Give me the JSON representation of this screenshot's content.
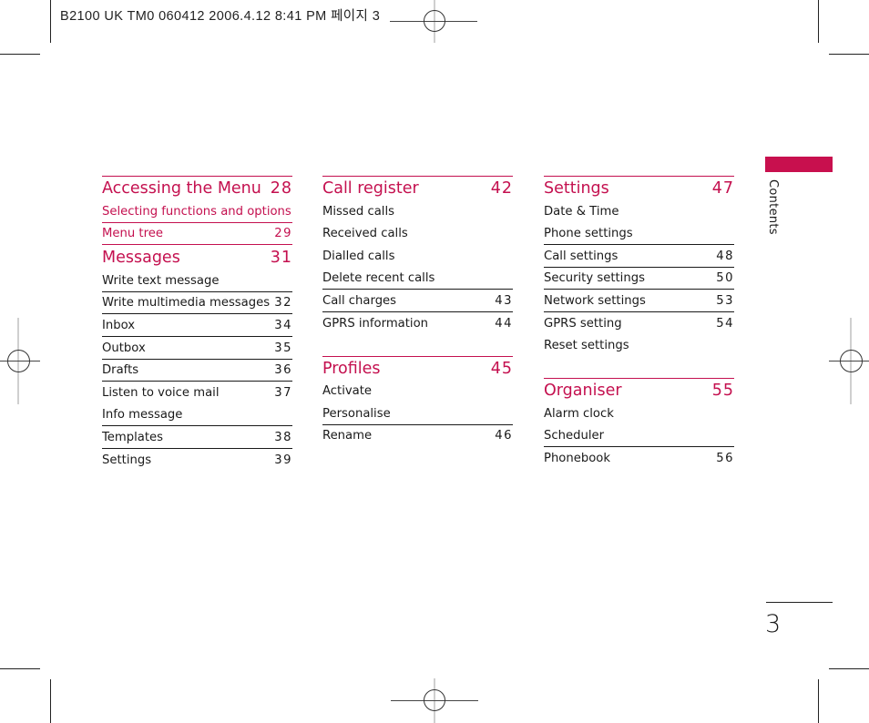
{
  "print_header": {
    "text": "B2100 UK TM0 060412  2006.4.12 8:41 PM 페이지 3"
  },
  "side_tab": {
    "label": "Contents",
    "accent_color": "#c8104e"
  },
  "page_number": "3",
  "columns": [
    {
      "entries": [
        {
          "type": "section",
          "label": "Accessing the Menu",
          "page": "28",
          "separator": false
        },
        {
          "type": "sub",
          "label": "Selecting functions and options",
          "page": "",
          "separator": false
        },
        {
          "type": "sub",
          "label": "Menu tree",
          "page": "29",
          "separator": true
        },
        {
          "type": "section",
          "label": "Messages",
          "page": "31",
          "separator": true
        },
        {
          "type": "item",
          "label": "Write text message",
          "page": "",
          "separator": false
        },
        {
          "type": "item",
          "label": "Write multimedia messages",
          "page": "32",
          "separator": true
        },
        {
          "type": "item",
          "label": "Inbox",
          "page": "34",
          "separator": true
        },
        {
          "type": "item",
          "label": "Outbox",
          "page": "35",
          "separator": true
        },
        {
          "type": "item",
          "label": "Drafts",
          "page": "36",
          "separator": true
        },
        {
          "type": "item",
          "label": "Listen to voice mail",
          "page": "37",
          "separator": true
        },
        {
          "type": "item",
          "label": "Info message",
          "page": "",
          "separator": false
        },
        {
          "type": "item",
          "label": "Templates",
          "page": "38",
          "separator": true
        },
        {
          "type": "item",
          "label": "Settings",
          "page": "39",
          "separator": true
        }
      ]
    },
    {
      "entries": [
        {
          "type": "section",
          "label": "Call register",
          "page": "42",
          "separator": false
        },
        {
          "type": "item",
          "label": "Missed calls",
          "page": "",
          "separator": false
        },
        {
          "type": "item",
          "label": "Received calls",
          "page": "",
          "separator": false
        },
        {
          "type": "item",
          "label": "Dialled calls",
          "page": "",
          "separator": false
        },
        {
          "type": "item",
          "label": "Delete recent calls",
          "page": "",
          "separator": false
        },
        {
          "type": "item",
          "label": "Call charges",
          "page": "43",
          "separator": true
        },
        {
          "type": "item",
          "label": "GPRS information",
          "page": "44",
          "separator": true
        },
        {
          "type": "gap"
        },
        {
          "type": "section",
          "label": "Profiles",
          "page": "45",
          "separator": false
        },
        {
          "type": "item",
          "label": "Activate",
          "page": "",
          "separator": false
        },
        {
          "type": "item",
          "label": "Personalise",
          "page": "",
          "separator": false
        },
        {
          "type": "item",
          "label": "Rename",
          "page": "46",
          "separator": true
        }
      ]
    },
    {
      "entries": [
        {
          "type": "section",
          "label": "Settings",
          "page": "47",
          "separator": false
        },
        {
          "type": "item",
          "label": "Date & Time",
          "page": "",
          "separator": false
        },
        {
          "type": "item",
          "label": "Phone settings",
          "page": "",
          "separator": false
        },
        {
          "type": "item",
          "label": "Call settings",
          "page": "48",
          "separator": true
        },
        {
          "type": "item",
          "label": "Security settings",
          "page": "50",
          "separator": true
        },
        {
          "type": "item",
          "label": "Network settings",
          "page": "53",
          "separator": true
        },
        {
          "type": "item",
          "label": "GPRS setting",
          "page": "54",
          "separator": true
        },
        {
          "type": "item",
          "label": "Reset settings",
          "page": "",
          "separator": false
        },
        {
          "type": "gap"
        },
        {
          "type": "section",
          "label": "Organiser",
          "page": "55",
          "separator": false
        },
        {
          "type": "item",
          "label": "Alarm clock",
          "page": "",
          "separator": false
        },
        {
          "type": "item",
          "label": "Scheduler",
          "page": "",
          "separator": false
        },
        {
          "type": "item",
          "label": "Phonebook",
          "page": "56",
          "separator": true
        }
      ]
    }
  ]
}
